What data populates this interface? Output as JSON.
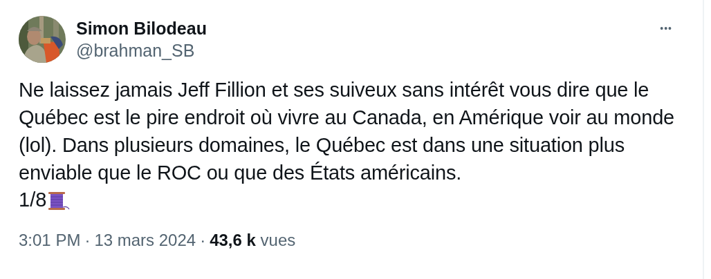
{
  "author": {
    "name": "Simon Bilodeau",
    "handle": "@brahman_SB"
  },
  "more_button": {
    "label": "•••"
  },
  "body": {
    "text": "Ne laissez jamais Jeff Fillion et ses suiveux sans intérêt vous dire que le\nQuébec est le pire endroit où vivre au Canada, en Amérique voir au monde\n(lol). Dans plusieurs domaines, le Québec est dans une situation plus\nenviable que le ROC ou que des États américains.",
    "thread_count": "1/8"
  },
  "meta": {
    "time": "3:01 PM",
    "separator_1": "·",
    "date": "13 mars 2024",
    "separator_2": "·",
    "views": "**43,6 k** vues"
  }
}
